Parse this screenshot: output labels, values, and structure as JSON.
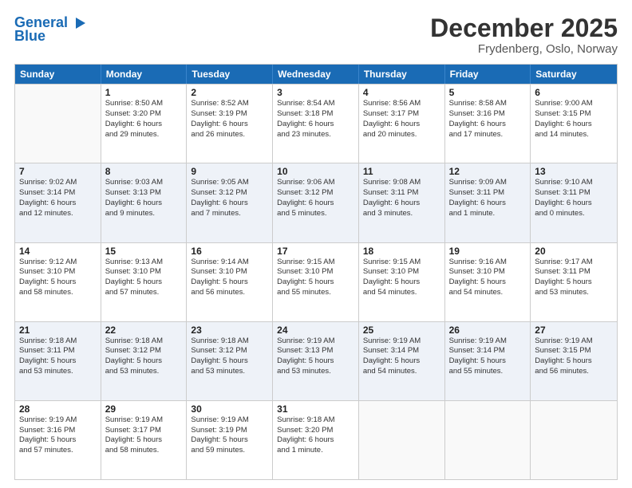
{
  "logo": {
    "line1": "General",
    "line2": "Blue"
  },
  "title": "December 2025",
  "location": "Frydenberg, Oslo, Norway",
  "days_of_week": [
    "Sunday",
    "Monday",
    "Tuesday",
    "Wednesday",
    "Thursday",
    "Friday",
    "Saturday"
  ],
  "weeks": [
    [
      {
        "day": "",
        "sunrise": "",
        "sunset": "",
        "daylight": "",
        "empty": true
      },
      {
        "day": "1",
        "sunrise": "Sunrise: 8:50 AM",
        "sunset": "Sunset: 3:20 PM",
        "daylight": "Daylight: 6 hours",
        "daylight2": "and 29 minutes."
      },
      {
        "day": "2",
        "sunrise": "Sunrise: 8:52 AM",
        "sunset": "Sunset: 3:19 PM",
        "daylight": "Daylight: 6 hours",
        "daylight2": "and 26 minutes."
      },
      {
        "day": "3",
        "sunrise": "Sunrise: 8:54 AM",
        "sunset": "Sunset: 3:18 PM",
        "daylight": "Daylight: 6 hours",
        "daylight2": "and 23 minutes."
      },
      {
        "day": "4",
        "sunrise": "Sunrise: 8:56 AM",
        "sunset": "Sunset: 3:17 PM",
        "daylight": "Daylight: 6 hours",
        "daylight2": "and 20 minutes."
      },
      {
        "day": "5",
        "sunrise": "Sunrise: 8:58 AM",
        "sunset": "Sunset: 3:16 PM",
        "daylight": "Daylight: 6 hours",
        "daylight2": "and 17 minutes."
      },
      {
        "day": "6",
        "sunrise": "Sunrise: 9:00 AM",
        "sunset": "Sunset: 3:15 PM",
        "daylight": "Daylight: 6 hours",
        "daylight2": "and 14 minutes."
      }
    ],
    [
      {
        "day": "7",
        "sunrise": "Sunrise: 9:02 AM",
        "sunset": "Sunset: 3:14 PM",
        "daylight": "Daylight: 6 hours",
        "daylight2": "and 12 minutes."
      },
      {
        "day": "8",
        "sunrise": "Sunrise: 9:03 AM",
        "sunset": "Sunset: 3:13 PM",
        "daylight": "Daylight: 6 hours",
        "daylight2": "and 9 minutes."
      },
      {
        "day": "9",
        "sunrise": "Sunrise: 9:05 AM",
        "sunset": "Sunset: 3:12 PM",
        "daylight": "Daylight: 6 hours",
        "daylight2": "and 7 minutes."
      },
      {
        "day": "10",
        "sunrise": "Sunrise: 9:06 AM",
        "sunset": "Sunset: 3:12 PM",
        "daylight": "Daylight: 6 hours",
        "daylight2": "and 5 minutes."
      },
      {
        "day": "11",
        "sunrise": "Sunrise: 9:08 AM",
        "sunset": "Sunset: 3:11 PM",
        "daylight": "Daylight: 6 hours",
        "daylight2": "and 3 minutes."
      },
      {
        "day": "12",
        "sunrise": "Sunrise: 9:09 AM",
        "sunset": "Sunset: 3:11 PM",
        "daylight": "Daylight: 6 hours",
        "daylight2": "and 1 minute."
      },
      {
        "day": "13",
        "sunrise": "Sunrise: 9:10 AM",
        "sunset": "Sunset: 3:11 PM",
        "daylight": "Daylight: 6 hours",
        "daylight2": "and 0 minutes."
      }
    ],
    [
      {
        "day": "14",
        "sunrise": "Sunrise: 9:12 AM",
        "sunset": "Sunset: 3:10 PM",
        "daylight": "Daylight: 5 hours",
        "daylight2": "and 58 minutes."
      },
      {
        "day": "15",
        "sunrise": "Sunrise: 9:13 AM",
        "sunset": "Sunset: 3:10 PM",
        "daylight": "Daylight: 5 hours",
        "daylight2": "and 57 minutes."
      },
      {
        "day": "16",
        "sunrise": "Sunrise: 9:14 AM",
        "sunset": "Sunset: 3:10 PM",
        "daylight": "Daylight: 5 hours",
        "daylight2": "and 56 minutes."
      },
      {
        "day": "17",
        "sunrise": "Sunrise: 9:15 AM",
        "sunset": "Sunset: 3:10 PM",
        "daylight": "Daylight: 5 hours",
        "daylight2": "and 55 minutes."
      },
      {
        "day": "18",
        "sunrise": "Sunrise: 9:15 AM",
        "sunset": "Sunset: 3:10 PM",
        "daylight": "Daylight: 5 hours",
        "daylight2": "and 54 minutes."
      },
      {
        "day": "19",
        "sunrise": "Sunrise: 9:16 AM",
        "sunset": "Sunset: 3:10 PM",
        "daylight": "Daylight: 5 hours",
        "daylight2": "and 54 minutes."
      },
      {
        "day": "20",
        "sunrise": "Sunrise: 9:17 AM",
        "sunset": "Sunset: 3:11 PM",
        "daylight": "Daylight: 5 hours",
        "daylight2": "and 53 minutes."
      }
    ],
    [
      {
        "day": "21",
        "sunrise": "Sunrise: 9:18 AM",
        "sunset": "Sunset: 3:11 PM",
        "daylight": "Daylight: 5 hours",
        "daylight2": "and 53 minutes."
      },
      {
        "day": "22",
        "sunrise": "Sunrise: 9:18 AM",
        "sunset": "Sunset: 3:12 PM",
        "daylight": "Daylight: 5 hours",
        "daylight2": "and 53 minutes."
      },
      {
        "day": "23",
        "sunrise": "Sunrise: 9:18 AM",
        "sunset": "Sunset: 3:12 PM",
        "daylight": "Daylight: 5 hours",
        "daylight2": "and 53 minutes."
      },
      {
        "day": "24",
        "sunrise": "Sunrise: 9:19 AM",
        "sunset": "Sunset: 3:13 PM",
        "daylight": "Daylight: 5 hours",
        "daylight2": "and 53 minutes."
      },
      {
        "day": "25",
        "sunrise": "Sunrise: 9:19 AM",
        "sunset": "Sunset: 3:14 PM",
        "daylight": "Daylight: 5 hours",
        "daylight2": "and 54 minutes."
      },
      {
        "day": "26",
        "sunrise": "Sunrise: 9:19 AM",
        "sunset": "Sunset: 3:14 PM",
        "daylight": "Daylight: 5 hours",
        "daylight2": "and 55 minutes."
      },
      {
        "day": "27",
        "sunrise": "Sunrise: 9:19 AM",
        "sunset": "Sunset: 3:15 PM",
        "daylight": "Daylight: 5 hours",
        "daylight2": "and 56 minutes."
      }
    ],
    [
      {
        "day": "28",
        "sunrise": "Sunrise: 9:19 AM",
        "sunset": "Sunset: 3:16 PM",
        "daylight": "Daylight: 5 hours",
        "daylight2": "and 57 minutes."
      },
      {
        "day": "29",
        "sunrise": "Sunrise: 9:19 AM",
        "sunset": "Sunset: 3:17 PM",
        "daylight": "Daylight: 5 hours",
        "daylight2": "and 58 minutes."
      },
      {
        "day": "30",
        "sunrise": "Sunrise: 9:19 AM",
        "sunset": "Sunset: 3:19 PM",
        "daylight": "Daylight: 5 hours",
        "daylight2": "and 59 minutes."
      },
      {
        "day": "31",
        "sunrise": "Sunrise: 9:18 AM",
        "sunset": "Sunset: 3:20 PM",
        "daylight": "Daylight: 6 hours",
        "daylight2": "and 1 minute."
      },
      {
        "day": "",
        "sunrise": "",
        "sunset": "",
        "daylight": "",
        "daylight2": "",
        "empty": true
      },
      {
        "day": "",
        "sunrise": "",
        "sunset": "",
        "daylight": "",
        "daylight2": "",
        "empty": true
      },
      {
        "day": "",
        "sunrise": "",
        "sunset": "",
        "daylight": "",
        "daylight2": "",
        "empty": true
      }
    ]
  ]
}
